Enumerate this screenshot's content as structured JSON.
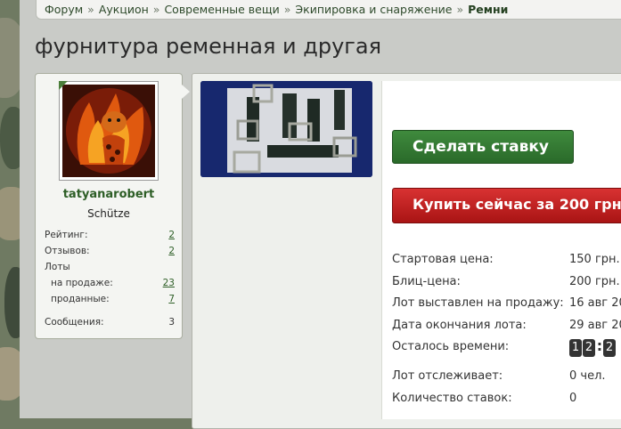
{
  "breadcrumb": {
    "items": [
      "Форум",
      "Аукцион",
      "Современные вещи",
      "Экипировка и снаряжение",
      "Ремни"
    ],
    "separator": "»"
  },
  "page": {
    "title": "фурнитура ременная и другая"
  },
  "user": {
    "name": "tatyanarobert",
    "rank": "Schütze",
    "stats": {
      "rating_label": "Рейтинг:",
      "rating_value": "2",
      "reviews_label": "Отзывов:",
      "reviews_value": "2",
      "lots_label": "Лоты",
      "on_sale_label": "на продаже:",
      "on_sale_value": "23",
      "sold_label": "проданные:",
      "sold_value": "7",
      "messages_label": "Сообщения:",
      "messages_value": "3"
    }
  },
  "lot": {
    "bid_button": "Сделать ставку",
    "buy_button": "Купить сейчас за 200 грн.",
    "details": [
      {
        "label": "Стартовая цена:",
        "value": "150 грн."
      },
      {
        "label": "Блиц-цена:",
        "value": "200 грн."
      },
      {
        "label": "Лот выставлен на продажу:",
        "value": "16 авг 20"
      },
      {
        "label": "Дата окончания лота:",
        "value": "29 авг 20"
      },
      {
        "label": "Осталось времени:",
        "value": ""
      },
      {
        "label": "Лот отслеживает:",
        "value": "0 чел."
      },
      {
        "label": "Количество ставок:",
        "value": "0"
      }
    ],
    "timer_digits": [
      "1",
      "2",
      ":",
      "2"
    ]
  }
}
